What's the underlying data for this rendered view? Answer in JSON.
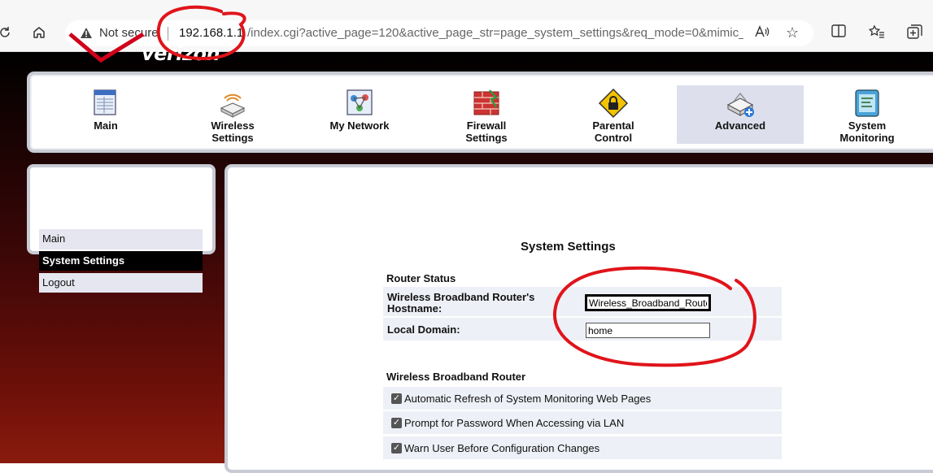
{
  "browser": {
    "security_label": "Not secure",
    "url_host": "192.168.1.1",
    "url_path": "/index.cgi?active_page=120&active_page_str=page_system_settings&req_mode=0&mimic_b...",
    "read_aloud_glyph": "A⁾"
  },
  "logo": {
    "text": "verizon"
  },
  "nav": {
    "items": [
      {
        "label1": "Main",
        "label2": "",
        "icon": "main-icon"
      },
      {
        "label1": "Wireless",
        "label2": "Settings",
        "icon": "wireless-icon"
      },
      {
        "label1": "My Network",
        "label2": "",
        "icon": "network-icon"
      },
      {
        "label1": "Firewall",
        "label2": "Settings",
        "icon": "firewall-icon"
      },
      {
        "label1": "Parental",
        "label2": "Control",
        "icon": "parental-icon"
      },
      {
        "label1": "Advanced",
        "label2": "",
        "icon": "advanced-icon"
      },
      {
        "label1": "System",
        "label2": "Monitoring",
        "icon": "monitoring-icon"
      }
    ],
    "active": "Advanced"
  },
  "sidebar": {
    "items": [
      {
        "label": "Main"
      },
      {
        "label": "System Settings"
      },
      {
        "label": "Logout"
      }
    ],
    "active": "System Settings"
  },
  "main": {
    "title": "System Settings",
    "router_status": {
      "heading": "Router Status",
      "hostname_label": "Wireless Broadband Router's Hostname:",
      "hostname_value": "Wireless_Broadband_Router",
      "domain_label": "Local Domain:",
      "domain_value": "home"
    },
    "router_section": {
      "heading": "Wireless Broadband Router",
      "options": [
        {
          "label": "Automatic Refresh of System Monitoring Web Pages",
          "checked": true
        },
        {
          "label": "Prompt for Password When Accessing via LAN",
          "checked": true
        },
        {
          "label": "Warn User Before Configuration Changes",
          "checked": true
        }
      ]
    }
  },
  "colors": {
    "annotation": "#e0141b",
    "nav_active": "#dde0ec",
    "row_bg": "#eef0f7",
    "panel_border": "#c9cbd4"
  }
}
